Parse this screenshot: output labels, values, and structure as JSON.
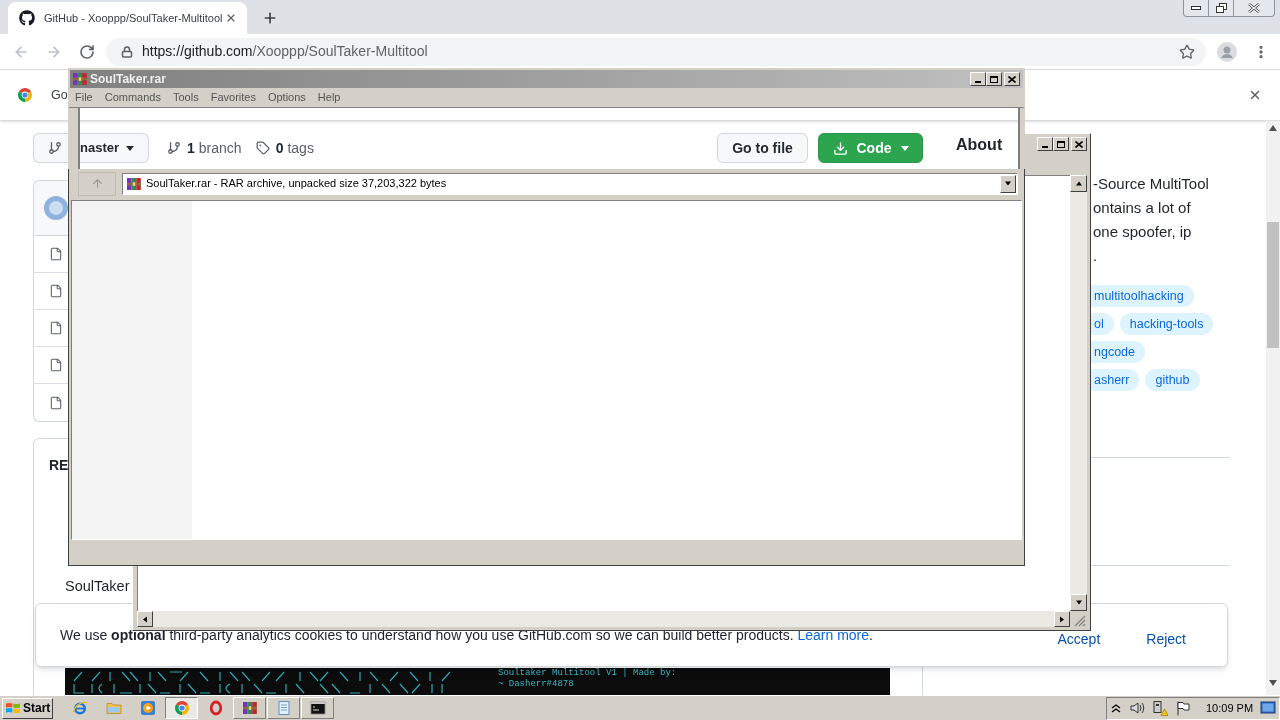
{
  "browser": {
    "tab": {
      "title": "GitHub - Xooppp/SoulTaker-Multitool",
      "selected": true
    },
    "nav": [
      {
        "kind": "back",
        "disabled": true
      },
      {
        "kind": "forward",
        "disabled": true
      },
      {
        "kind": "reload",
        "disabled": false
      }
    ],
    "address": {
      "host": "https://github.com",
      "path": "/Xooppp/SoulTaker-Multitool"
    },
    "infobar": {
      "text": "Go"
    }
  },
  "repo": {
    "branch_button": {
      "label": "naster"
    },
    "counts": [
      {
        "kind": "branch",
        "count": "1",
        "label": "branch"
      },
      {
        "kind": "tag",
        "count": "0",
        "label": "tags"
      }
    ],
    "buttons": [
      {
        "kind": "secondary",
        "label": "Go to file"
      },
      {
        "kind": "primary",
        "label": "Code"
      }
    ],
    "file_rows": [
      {
        "kind": "file"
      },
      {
        "kind": "file"
      },
      {
        "kind": "file"
      },
      {
        "kind": "file"
      },
      {
        "kind": "file"
      }
    ],
    "readme": {
      "heading": "RE",
      "text": "SoulTaker",
      "terminal_lines": [
        "Soultaker Multitool V1 | Made by:",
        "~ Dasherr#4878"
      ]
    },
    "about": {
      "heading": "About",
      "description_lines": [
        "-Source MultiTool",
        "ontains a lot of",
        "one spoofer, ip",
        "."
      ],
      "topic_rows": [
        [
          "multitoolhacking"
        ],
        [
          "ol",
          "hacking-tools"
        ],
        [
          "ngcode"
        ],
        [
          "asherr",
          "github"
        ]
      ]
    }
  },
  "cookie_banner": {
    "text": "We use **optional** third-party analytics cookies to understand how you use GitHub.com so we can build better products.",
    "link": "Learn more",
    "after_link": ".",
    "actions": [
      "Accept",
      "Reject"
    ]
  },
  "archiver": {
    "title": "SoulTaker.rar",
    "menu": [
      "File",
      "Commands",
      "Tools",
      "Favorites",
      "Options",
      "Help"
    ],
    "up_disabled": true,
    "path": "SoulTaker.rar - RAR archive, unpacked size 37,203,322 bytes"
  },
  "taskbar": {
    "start": "Start",
    "items": [
      {
        "kind": "ie",
        "running": false,
        "selected": false
      },
      {
        "kind": "folder",
        "running": false,
        "selected": false
      },
      {
        "kind": "media",
        "running": false,
        "selected": false
      },
      {
        "kind": "chrome",
        "running": true,
        "selected": true
      },
      {
        "kind": "opera",
        "running": false,
        "selected": false
      },
      {
        "kind": "winrar",
        "running": true,
        "selected": false
      },
      {
        "kind": "notepad",
        "running": true,
        "selected": false
      },
      {
        "kind": "cmd",
        "running": true,
        "selected": false
      }
    ],
    "clock": "10:09 PM"
  }
}
